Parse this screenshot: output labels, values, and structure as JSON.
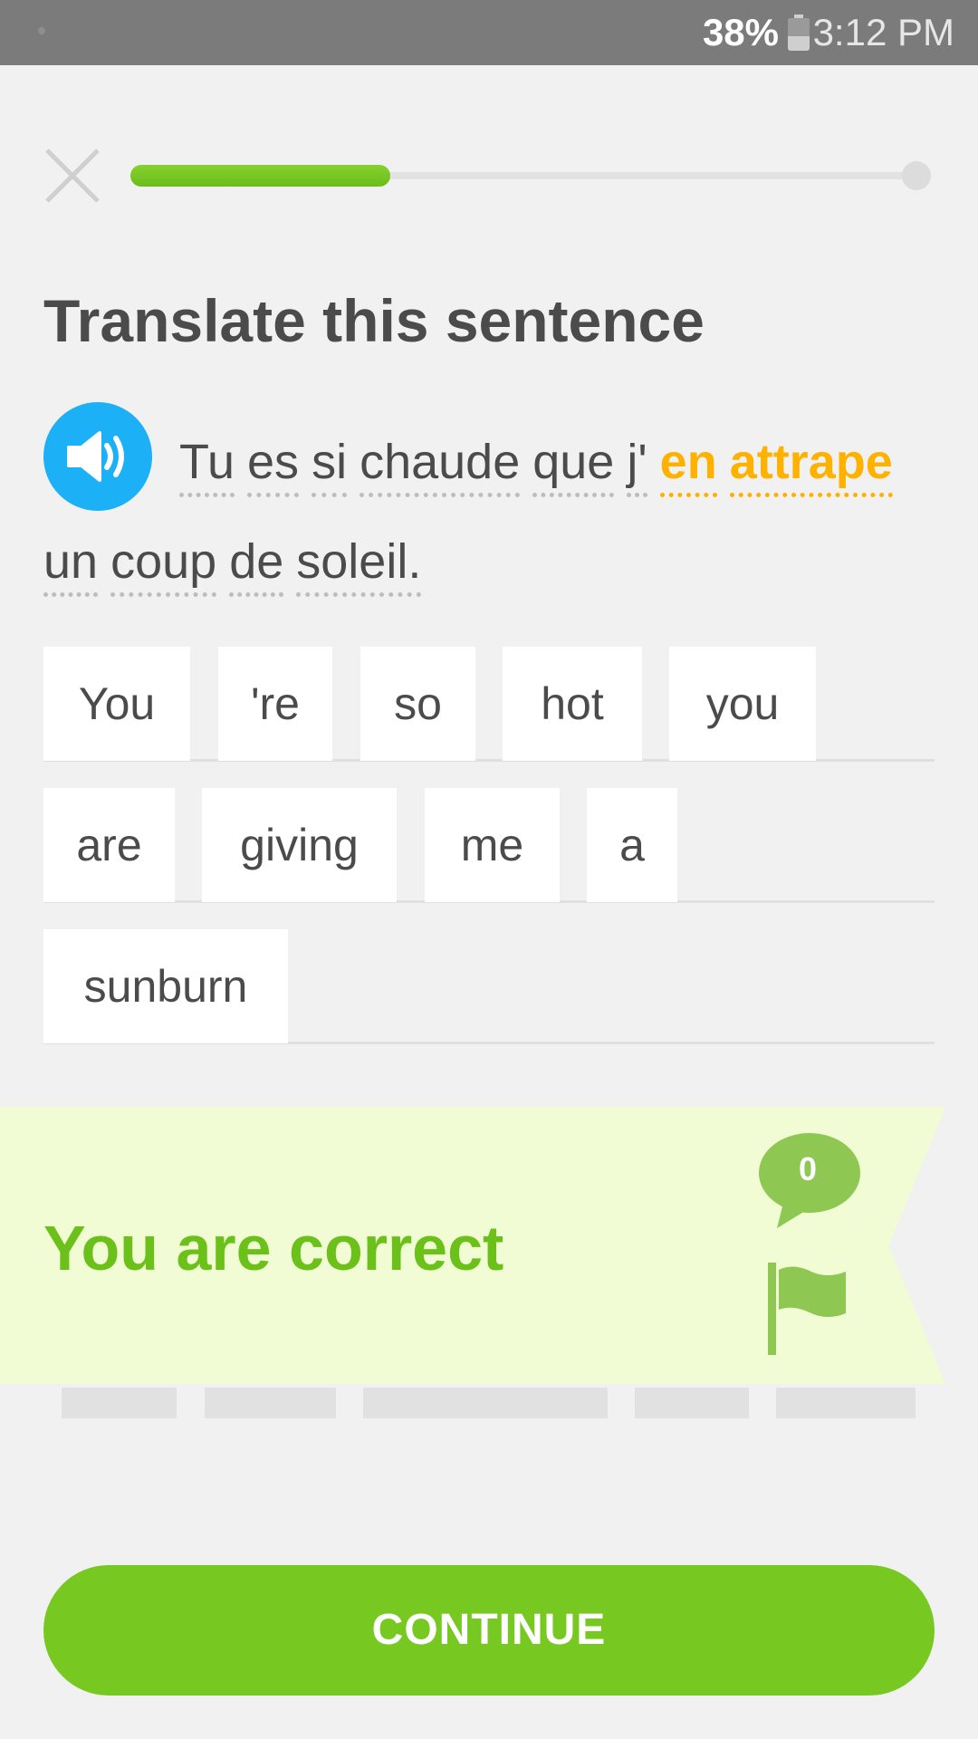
{
  "status_bar": {
    "battery": "38%",
    "time": "3:12 PM"
  },
  "lesson": {
    "progress": 0.33
  },
  "prompt": {
    "title": "Translate this sentence",
    "words": [
      "Tu",
      "es",
      "si",
      "chaude",
      "que",
      "j'",
      "en",
      "attrape",
      "un",
      "coup",
      "de",
      "soleil."
    ],
    "highlighted_words": [
      "en",
      "attrape"
    ]
  },
  "answer": {
    "rows": [
      [
        "You",
        "'re",
        "so",
        "hot",
        "you"
      ],
      [
        "are",
        "giving",
        "me",
        "a"
      ],
      [
        "sunburn"
      ]
    ]
  },
  "feedback": {
    "message": "You are correct",
    "comment_count": "0"
  },
  "continue_label": "CONTINUE",
  "icons": {
    "close": "close-icon",
    "speaker": "speaker-icon",
    "comment": "comment-icon",
    "flag": "flag-icon",
    "battery": "battery-icon"
  },
  "colors": {
    "green": "#77c922",
    "blue": "#1cb0f6",
    "orange": "#ffb100",
    "banner": "#f1fcd5"
  }
}
